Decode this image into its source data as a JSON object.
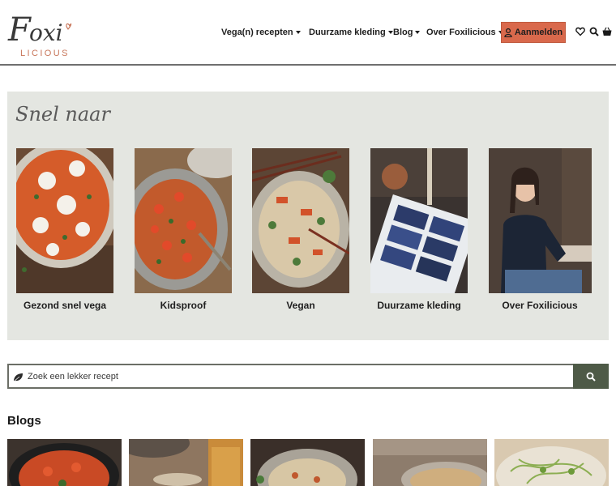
{
  "brand": {
    "logo_main": "Foxi",
    "logo_sub": "LICIOUS",
    "accent": "#d9694c",
    "panel_bg": "#e4e6e1",
    "search_button": "#4e5a47"
  },
  "nav": {
    "items": [
      {
        "label": "Vega(n) recepten",
        "has_dropdown": true
      },
      {
        "label": "Duurzame kleding",
        "has_dropdown": true
      },
      {
        "label": "Blog",
        "has_dropdown": true
      },
      {
        "label": "Over Foxilicious",
        "has_dropdown": true
      }
    ],
    "login_label": "Aanmelden",
    "icons": [
      "heart-icon",
      "search-icon",
      "basket-icon"
    ]
  },
  "quicklinks": {
    "title": "Snel naar",
    "cards": [
      {
        "label": "Gezond snel vega"
      },
      {
        "label": "Kidsproof"
      },
      {
        "label": "Vegan"
      },
      {
        "label": "Duurzame kleding"
      },
      {
        "label": "Over Foxilicious"
      }
    ]
  },
  "search": {
    "placeholder": "Zoek een lekker recept"
  },
  "blogs": {
    "title": "Blogs"
  }
}
